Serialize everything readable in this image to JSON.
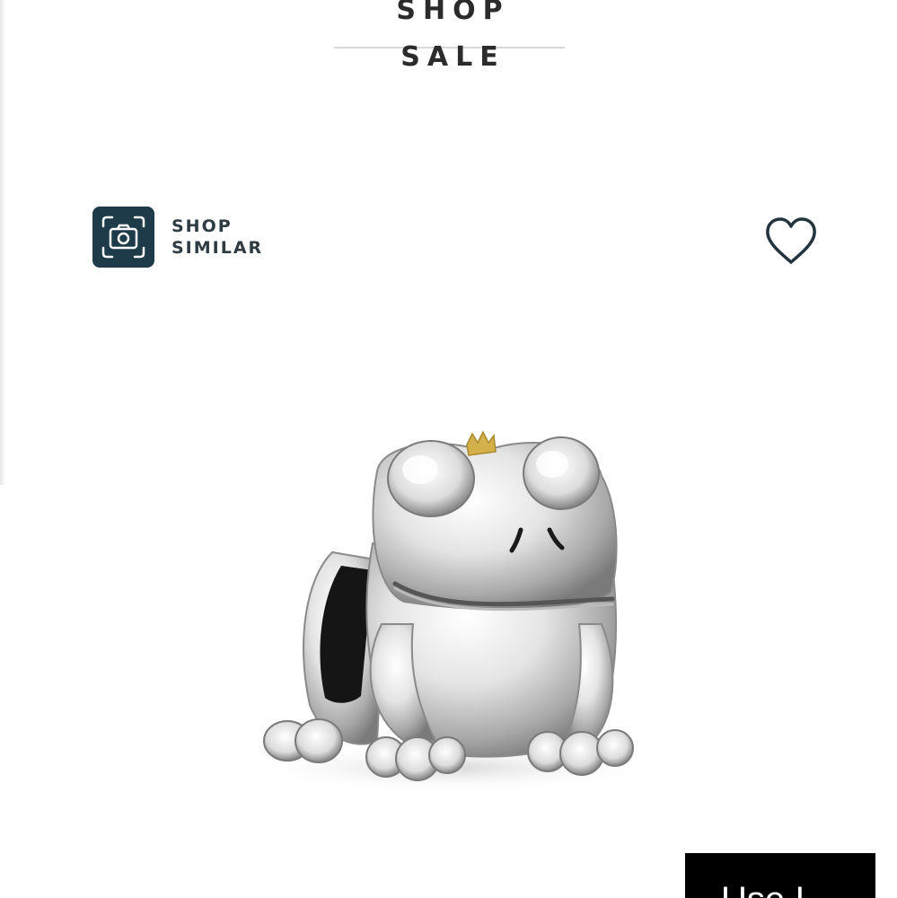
{
  "header": {
    "shop_sale_label": "SHOP SALE"
  },
  "shop_similar": {
    "line1": "SHOP",
    "line2": "SIMILAR",
    "icon": "camera-icon"
  },
  "wishlist": {
    "icon": "heart-icon"
  },
  "product": {
    "image": "frog-charm-image",
    "accent_color": "#d4b04a"
  },
  "cta": {
    "label": "Use I"
  },
  "colors": {
    "camera_box": "#1e3b4a",
    "text_dark": "#2b2b2b",
    "cta_bg": "#000000"
  }
}
